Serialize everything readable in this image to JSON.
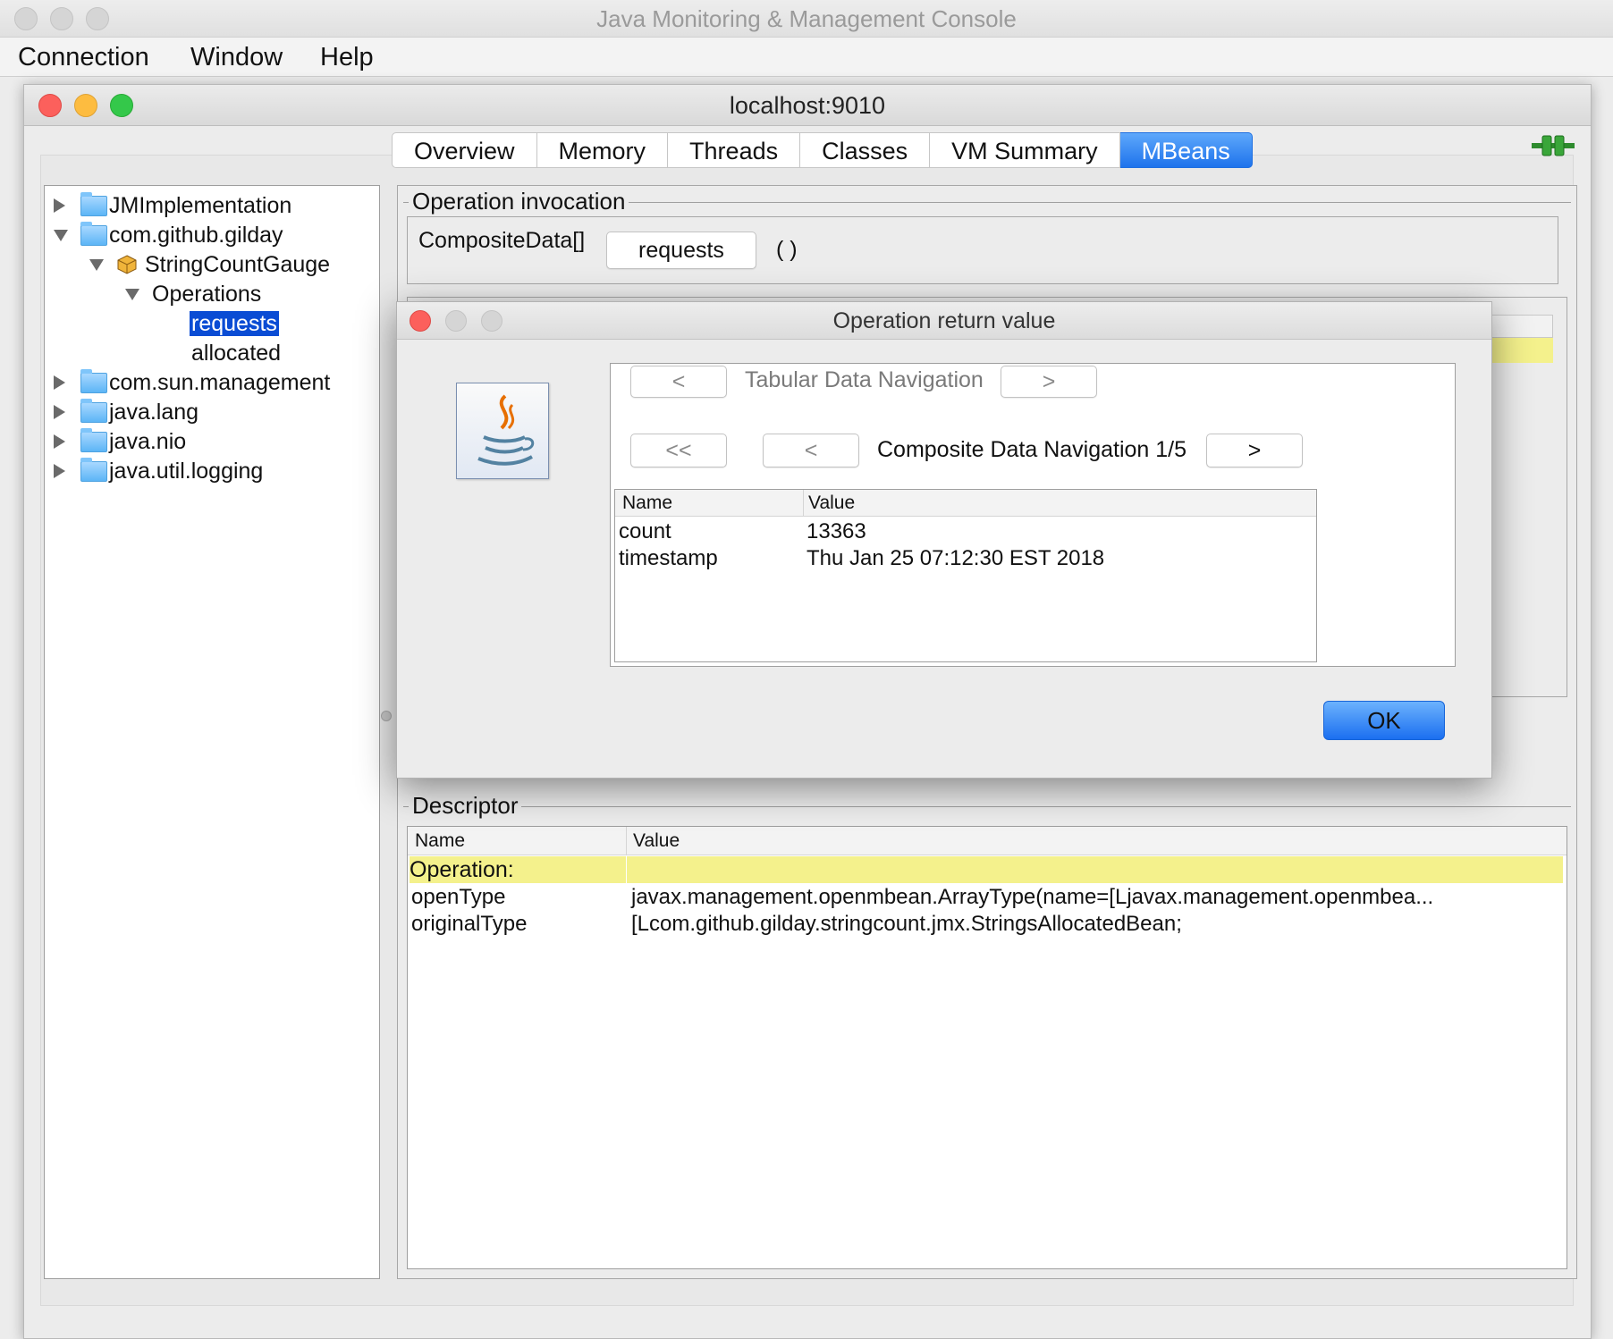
{
  "outer_window": {
    "title": "Java Monitoring & Management Console",
    "menu": [
      "Connection",
      "Window",
      "Help"
    ]
  },
  "inner_window": {
    "title": "localhost:9010",
    "tabs": [
      {
        "label": "Overview",
        "active": false
      },
      {
        "label": "Memory",
        "active": false
      },
      {
        "label": "Threads",
        "active": false
      },
      {
        "label": "Classes",
        "active": false
      },
      {
        "label": "VM Summary",
        "active": false
      },
      {
        "label": "MBeans",
        "active": true
      }
    ],
    "connection_icon": "plug-icon"
  },
  "tree": {
    "items": [
      {
        "label": "JMImplementation",
        "icon": "folder-icon",
        "expanded": false
      },
      {
        "label": "com.github.gilday",
        "icon": "folder-icon",
        "expanded": true
      },
      {
        "label": "StringCountGauge",
        "icon": "bean-icon",
        "expanded": true
      },
      {
        "label": "Operations",
        "icon": "",
        "expanded": true
      },
      {
        "label": "requests",
        "icon": "",
        "selected": true
      },
      {
        "label": "allocated",
        "icon": ""
      },
      {
        "label": "com.sun.management",
        "icon": "folder-icon",
        "expanded": false
      },
      {
        "label": "java.lang",
        "icon": "folder-icon",
        "expanded": false
      },
      {
        "label": "java.nio",
        "icon": "folder-icon",
        "expanded": false
      },
      {
        "label": "java.util.logging",
        "icon": "folder-icon",
        "expanded": false
      }
    ]
  },
  "invocation": {
    "legend": "Operation invocation",
    "return_type": "CompositeData[]",
    "operation_button": "requests",
    "params": "( )"
  },
  "dialog": {
    "title": "Operation return value",
    "tabular_prev": "<",
    "tabular_label": "Tabular Data Navigation",
    "tabular_next": ">",
    "composite_first": "<<",
    "composite_prev": "<",
    "composite_label": "Composite Data Navigation 1/5",
    "composite_next": ">",
    "table": {
      "columns": [
        "Name",
        "Value"
      ],
      "rows": [
        {
          "name": "count",
          "value": "13363"
        },
        {
          "name": "timestamp",
          "value": "Thu Jan 25 07:12:30 EST 2018"
        }
      ]
    },
    "ok": "OK"
  },
  "descriptor": {
    "legend": "Descriptor",
    "columns": [
      "Name",
      "Value"
    ],
    "rows": [
      {
        "name": "Operation:",
        "value": "",
        "highlight": true
      },
      {
        "name": "openType",
        "value": "javax.management.openmbean.ArrayType(name=[Ljavax.management.openmbea..."
      },
      {
        "name": "originalType",
        "value": "[Lcom.github.gilday.stringcount.jmx.StringsAllocatedBean;"
      }
    ]
  },
  "colors": {
    "accent": "#1e73ec",
    "selection": "#0a4cd4",
    "highlight_row": "#f4f18c",
    "close": "#fc605c",
    "minimize": "#fdbc40",
    "zoom": "#34c84a"
  }
}
